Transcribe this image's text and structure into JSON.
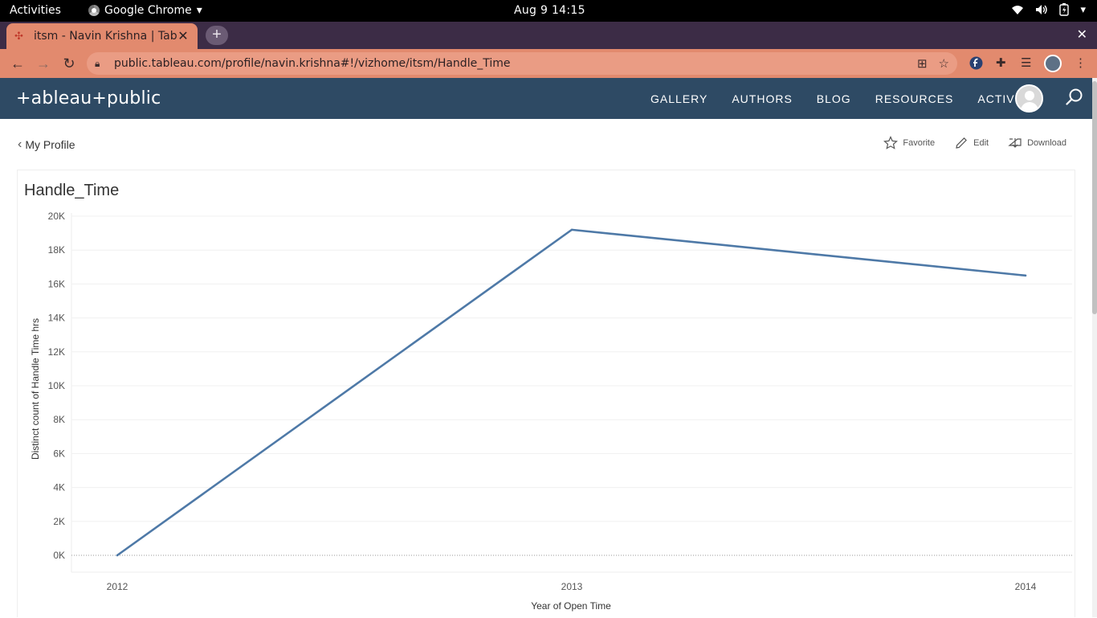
{
  "system": {
    "activities": "Activities",
    "app_name": "Google Chrome",
    "clock": "Aug 9  14:15"
  },
  "browser": {
    "tab_title": "itsm - Navin Krishna | Tabl",
    "url": "public.tableau.com/profile/navin.krishna#!/vizhome/itsm/Handle_Time"
  },
  "site": {
    "logo": "+ableau+public",
    "nav": [
      "GALLERY",
      "AUTHORS",
      "BLOG",
      "RESOURCES",
      "ACTIVITY"
    ],
    "back_label": "My Profile",
    "actions": {
      "favorite": "Favorite",
      "edit": "Edit",
      "download": "Download"
    }
  },
  "viz": {
    "title": "Handle_Time"
  },
  "colors": {
    "header": "#2e4a64",
    "tab": "#e28a6e",
    "line": "#4e79a7"
  },
  "chart_data": {
    "type": "line",
    "title": "Handle_Time",
    "xlabel": "Year of Open Time",
    "ylabel": "Distinct count of Handle Time hrs",
    "x": [
      "2012",
      "2013",
      "2014"
    ],
    "series": [
      {
        "values": [
          0,
          19200,
          16500
        ]
      }
    ],
    "ylim": [
      0,
      20000
    ],
    "yticks": [
      "0K",
      "2K",
      "4K",
      "6K",
      "8K",
      "10K",
      "12K",
      "14K",
      "16K",
      "18K",
      "20K"
    ],
    "ytick_values": [
      0,
      2000,
      4000,
      6000,
      8000,
      10000,
      12000,
      14000,
      16000,
      18000,
      20000
    ],
    "grid": true,
    "legend": "none"
  }
}
